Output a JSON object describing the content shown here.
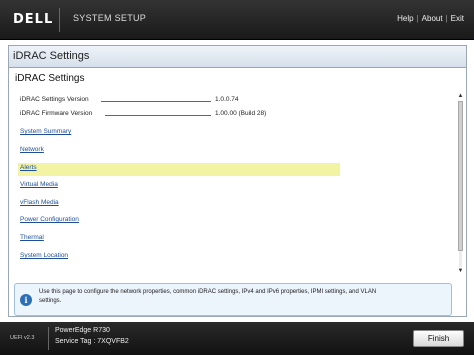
{
  "header": {
    "logo": "DELL",
    "title": "SYSTEM SETUP",
    "links": [
      "Help",
      "About",
      "Exit"
    ]
  },
  "panel": {
    "header_title": "iDRAC Settings",
    "section_title": "iDRAC Settings",
    "properties": [
      {
        "label": "iDRAC Settings Version",
        "value": "1.0.0.74"
      },
      {
        "label": "iDRAC Firmware Version",
        "value": "1.00.00 (Build 28)"
      }
    ],
    "nav_items": [
      {
        "label": "System Summary"
      },
      {
        "label": "Network"
      },
      {
        "label": "Alerts"
      },
      {
        "label": "Virtual Media"
      },
      {
        "label": "vFlash Media"
      },
      {
        "label": "Power Configuration"
      },
      {
        "label": "Thermal"
      },
      {
        "label": "System Location"
      }
    ],
    "selected_item": "Network",
    "info_text": "Use this page to configure the network properties, common iDRAC settings, IPv4 and IPv6 properties, IPMI settings, and VLAN settings."
  },
  "footer": {
    "uefi_version": "UEFI v2.3",
    "model": "PowerEdge R730",
    "service_tag": "Service Tag : 7XQVFB2",
    "finish_label": "Finish"
  }
}
